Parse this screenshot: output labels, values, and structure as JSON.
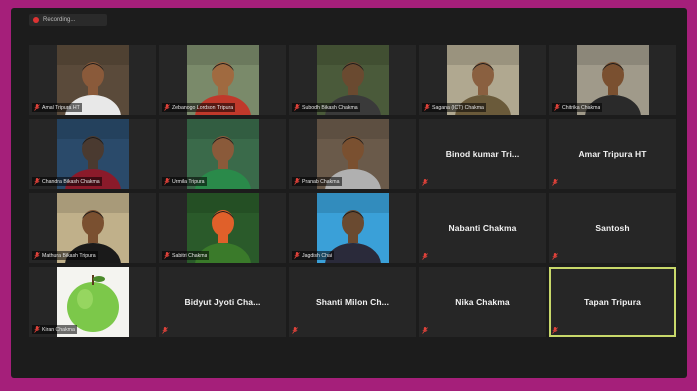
{
  "toolbar": {
    "recording_label": "Recording..."
  },
  "colors": {
    "border": "#a51f7a",
    "tile_bg": "#262626",
    "active_outline": "#c8d86a",
    "mic_muted": "#e0423a"
  },
  "participants": [
    {
      "name": "Amal Tripura HT",
      "video": true,
      "bg": "#5a4a3a",
      "skin": "#8a5a3a",
      "shirt": "#e8e8e8"
    },
    {
      "name": "Zebanogo Lordson Tripura",
      "video": true,
      "bg": "#7a8a6a",
      "skin": "#a06a40",
      "shirt": "#c0392b"
    },
    {
      "name": "Subodh Bikash Chakma",
      "video": true,
      "bg": "#4a5a3a",
      "skin": "#6a4a30",
      "shirt": "#3a3a3a"
    },
    {
      "name": "Sagana (ICT) Chakma",
      "video": true,
      "bg": "#b0a890",
      "skin": "#8a6040",
      "shirt": "#6a5a3a"
    },
    {
      "name": "Chitrika Chakma",
      "video": true,
      "bg": "#a09a8a",
      "skin": "#7a5030",
      "shirt": "#2a2a2a"
    },
    {
      "name": "Chandra Bikash Chakma",
      "video": true,
      "bg": "#2a4a6a",
      "skin": "#4a3a30",
      "shirt": "#8a1a2a"
    },
    {
      "name": "Urmila Tripura",
      "video": true,
      "bg": "#3a6a4a",
      "skin": "#8a5a3a",
      "shirt": "#2a8a4a"
    },
    {
      "name": "Pranab Chakma",
      "video": true,
      "bg": "#6a5a4a",
      "skin": "#7a5030",
      "shirt": "#b0b0b0"
    },
    {
      "name": "Binod kumar Tri...",
      "video": false
    },
    {
      "name": "Amar Tripura HT",
      "video": false
    },
    {
      "name": "Mathura Bikash Tripura",
      "video": true,
      "bg": "#c0b08a",
      "skin": "#7a5030",
      "shirt": "#1a1a1a"
    },
    {
      "name": "Sabitri Chakma",
      "video": true,
      "bg": "#2a5a2a",
      "skin": "#e0602a",
      "shirt": "#3a7a2a"
    },
    {
      "name": "Jagdish Chai",
      "video": true,
      "bg": "#3aa0d8",
      "skin": "#6a4a30",
      "shirt": "#2a2a3a"
    },
    {
      "name": "Nabanti Chakma",
      "video": false
    },
    {
      "name": "Santosh",
      "video": false
    },
    {
      "name": "Kiran Chakma",
      "video": true,
      "bg": "#f4f4f0",
      "apple": true
    },
    {
      "name": "Bidyut Jyoti Cha...",
      "video": false
    },
    {
      "name": "Shanti Milon Ch...",
      "video": false
    },
    {
      "name": "Nika Chakma",
      "video": false
    },
    {
      "name": "Tapan Tripura",
      "video": false,
      "active": true
    }
  ]
}
